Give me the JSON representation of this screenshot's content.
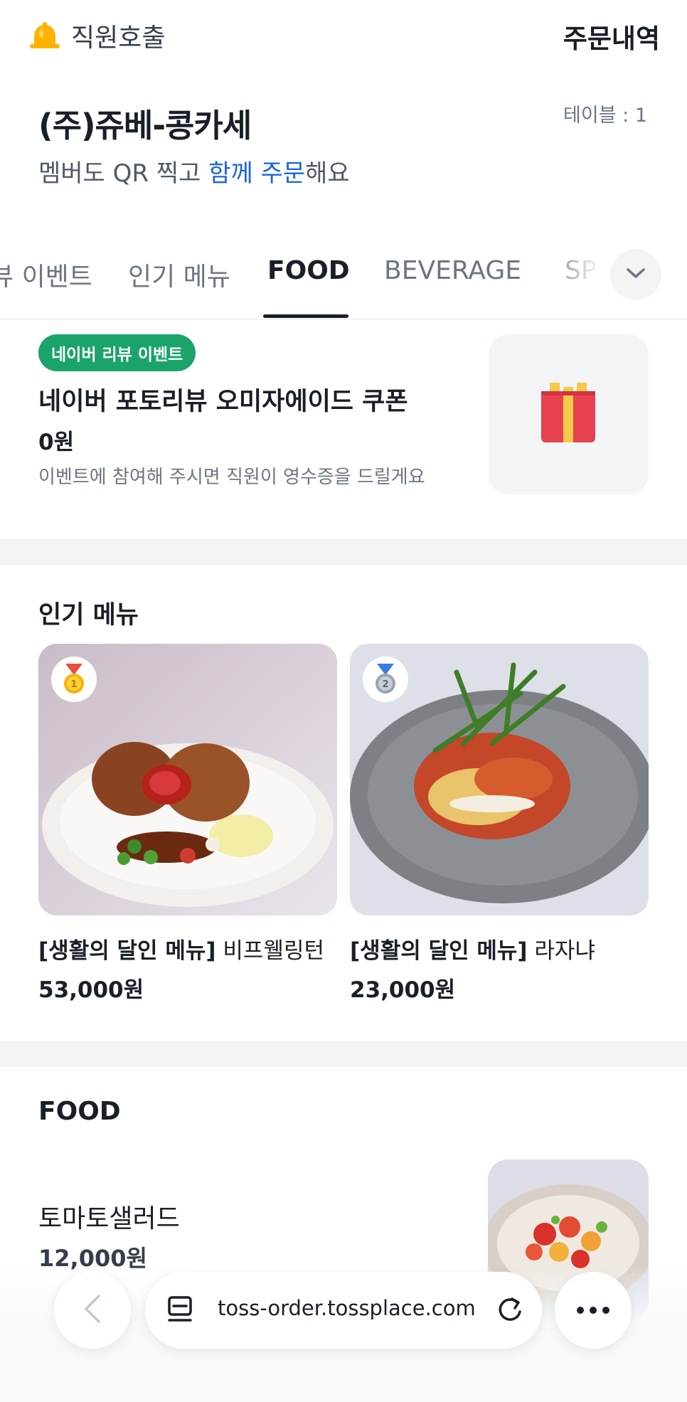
{
  "header": {
    "call_label": "직원호출",
    "orders_label": "주문내역"
  },
  "store": {
    "name": "(주)쥬베-콩카세",
    "table": "테이블 : 1",
    "tagline_prefix": "멤버도 QR 찍고 ",
    "tagline_highlight": "함께 주문",
    "tagline_suffix": "해요"
  },
  "tabs": [
    {
      "label": "뷰 이벤트"
    },
    {
      "label": "인기 메뉴"
    },
    {
      "label": "FOOD",
      "active": true
    },
    {
      "label": "BEVERAGE"
    },
    {
      "label": "SP"
    }
  ],
  "event": {
    "badge": "네이버 리뷰 이벤트",
    "title": "네이버 포토리뷰 오미자에이드 쿠폰",
    "price": "0원",
    "description": "이벤트에 참여해 주시면 직원이 영수증을 드릴게요"
  },
  "popular": {
    "title": "인기 메뉴",
    "items": [
      {
        "rank": "1",
        "prefix": "[생활의 달인 메뉴]",
        "name": " 비프웰링턴",
        "price": "53,000원"
      },
      {
        "rank": "2",
        "prefix": "[생활의 달인 메뉴]",
        "name": " 라자냐",
        "price": "23,000원"
      }
    ]
  },
  "food": {
    "title": "FOOD",
    "items": [
      {
        "name": "토마토샐러드",
        "price": "12,000원"
      }
    ]
  },
  "browser": {
    "url": "toss-order.tossplace.com"
  },
  "colors": {
    "accent_blue": "#1b64da",
    "badge_green": "#1aa36b",
    "divider": "#f2f4f6"
  }
}
